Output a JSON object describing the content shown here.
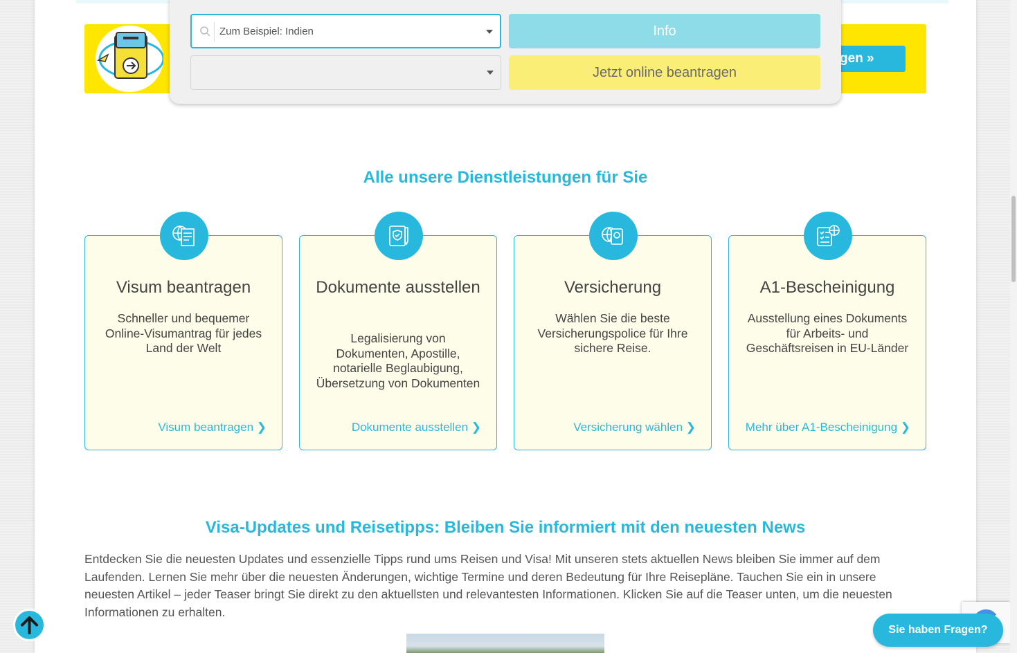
{
  "banner": {
    "button_label": "gen »"
  },
  "form": {
    "country_placeholder": "Zum Beispiel: Indien",
    "second_value": "",
    "info_label": "Info",
    "apply_label": "Jetzt online beantragen"
  },
  "services": {
    "title": "Alle unsere Dienstleistungen für Sie",
    "cards": [
      {
        "icon": "visa-globe-icon",
        "title": "Visum beantragen",
        "text": "Schneller und bequemer Online-Visumantrag für jedes Land der Welt",
        "link": "Visum beantragen ❯"
      },
      {
        "icon": "document-shield-icon",
        "title": "Dokumente ausstellen",
        "text": "Legalisierung von Dokumenten, Apostille, notarielle Beglaubigung, Übersetzung von Dokumenten",
        "link": "Dokumente ausstellen ❯"
      },
      {
        "icon": "insurance-globe-icon",
        "title": "Versicherung",
        "text": "Wählen Sie die beste Versicherungspolice für Ihre sichere Reise.",
        "link": "Versicherung wählen ❯"
      },
      {
        "icon": "checklist-globe-icon",
        "title": "A1-Bescheinigung",
        "text": "Ausstellung eines Dokuments für Arbeits- und Geschäftsreisen in EU-Länder",
        "link": "Mehr über A1-Bescheinigung ❯"
      }
    ]
  },
  "news": {
    "title": "Visa-Updates und Reisetipps: Bleiben Sie informiert mit den neuesten News",
    "intro": "Entdecken Sie die neuesten Updates und essenzielle Tipps rund ums Reisen und Visa! Mit unseren stets aktuellen News bleiben Sie immer auf dem Laufenden. Lernen Sie mehr über die neuesten Änderungen, wichtige Termine und deren Bedeutung für Ihre Reisepläne. Tauchen Sie ein in unsere neuesten Artikel – jeder Teaser bringt Sie direkt zu den aktuellsten und relevantesten Informationen. Klicken Sie auf die Teaser unten, um die neuesten Informationen zu erhalten."
  },
  "widgets": {
    "chat_label": "Sie haben Fragen?"
  },
  "colors": {
    "accent": "#29b8dd",
    "banner_yellow": "#ffe600",
    "card_bg": "#fefde9"
  }
}
